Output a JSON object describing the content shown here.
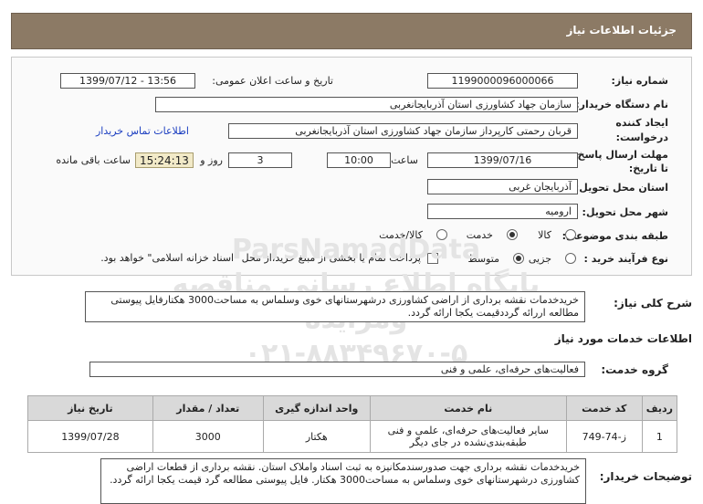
{
  "header": {
    "title": "جزئیات اطلاعات نیاز"
  },
  "form": {
    "need_number_label": "شماره نیاز:",
    "need_number": "1199000096000066",
    "announce_label": "تاریخ و ساعت اعلان عمومی:",
    "announce_value": "1399/07/12 - 13:56",
    "buyer_label": "نام دستگاه خریدار:",
    "buyer_value": "سازمان جهاد کشاورزی استان آذربایجانغربی",
    "creator_label_1": "ایجاد کننده",
    "creator_label_2": "درخواست:",
    "creator_value": "قربان  رحمتی  کارپرداز سازمان جهاد کشاورزی استان آذربایجانغربی",
    "contact_link": "اطلاعات تماس خریدار",
    "deadline_label_1": "مهلت ارسال پاسخ:",
    "deadline_label_2": "تا تاریخ:",
    "deadline_date": "1399/07/16",
    "time_label": "ساعت",
    "deadline_time": "10:00",
    "days_value": "3",
    "days_label": "روز و",
    "remaining_time": "15:24:13",
    "remaining_label": "ساعت باقی مانده",
    "province_label": "استان محل تحویل:",
    "province_value": "آذربایجان غربی",
    "city_label": "شهر محل تحویل:",
    "city_value": "ارومیه",
    "category_label": "طبقه بندی موضوعی:",
    "category_options": {
      "goods": "کالا",
      "service": "خدمت",
      "goods_service": "کالا/خدمت"
    },
    "process_label": "نوع فرآیند خرید :",
    "process_options": {
      "partial": "جزیی",
      "medium": "متوسط"
    },
    "payment_note": "پرداخت تمام یا بخشی از مبلغ خرید،از محل \"اسناد خزانه اسلامی\" خواهد بود."
  },
  "summary": {
    "label": "شرح کلی نیاز:",
    "text": "خریدخدمات نقشه برداری از اراضی کشاورزی درشهرستانهای خوی وسلماس به مساحت3000 هکتارفایل پیوستی مطالعه اررائه گرددقیمت یکجا ارائه گردد."
  },
  "services": {
    "section_title": "اطلاعات خدمات مورد نیاز",
    "group_label": "گروه خدمت:",
    "group_value": "فعالیت‌های حرفه‌ای، علمی و فنی",
    "columns": [
      "ردیف",
      "کد خدمت",
      "نام خدمت",
      "واحد اندازه گیری",
      "تعداد / مقدار",
      "تاریخ نیاز"
    ],
    "rows": [
      [
        "1",
        "ز-74-749",
        "سایر فعالیت‌های حرفه‌ای، علمی و فنی طبقه‌بندی‌نشده در جای دیگر",
        "هکتار",
        "3000",
        "1399/07/28"
      ]
    ]
  },
  "buyer_notes": {
    "label": "توضیحات خریدار:",
    "text": "خریدخدمات نقشه برداری جهت صدورسندمکانیزه به ثبت اسناد واملاک استان. نقشه برداری از قطعات اراضی کشاورزی درشهرستانهای خوی وسلماس به مساحت3000 هکتار. فایل پیوستی مطالعه گرد قیمت یکجا ارائه گردد."
  },
  "watermark": {
    "line1": "ParsNamadData",
    "line2": "پایگاه اطلاع رسانی مناقصه ومزایده",
    "line3": "۰۲۱-۸۸۳۴۹۶۷۰-۵"
  },
  "colors": {
    "header_bg": "#8c7a65",
    "link": "#1a3dc0",
    "timer_bg": "#f2eac8",
    "table_head": "#d9d9d9"
  }
}
